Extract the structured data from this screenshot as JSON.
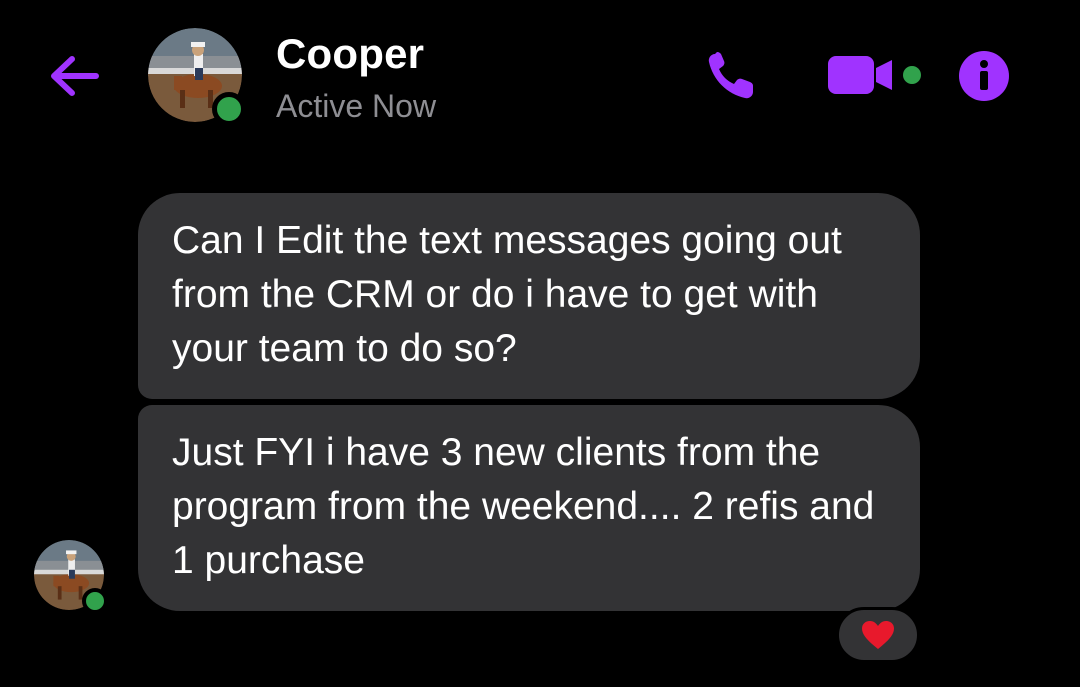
{
  "header": {
    "contact_name": "Cooper",
    "status": "Active Now",
    "icons": {
      "back": "back-arrow-icon",
      "call": "phone-icon",
      "video": "video-camera-icon",
      "info": "info-icon"
    },
    "accent_color": "#a033ff",
    "presence_color": "#31a24c"
  },
  "messages": [
    {
      "sender": "Cooper",
      "text": "Can I Edit the text messages going out from the CRM or do i have to get with your team to do so?"
    },
    {
      "sender": "Cooper",
      "text": "Just FYI i have 3 new clients from the program from the weekend.... 2 refis and 1 purchase",
      "reaction": "heart"
    }
  ],
  "colors": {
    "background": "#000000",
    "bubble": "#333335",
    "reaction_heart": "#e8192c"
  }
}
